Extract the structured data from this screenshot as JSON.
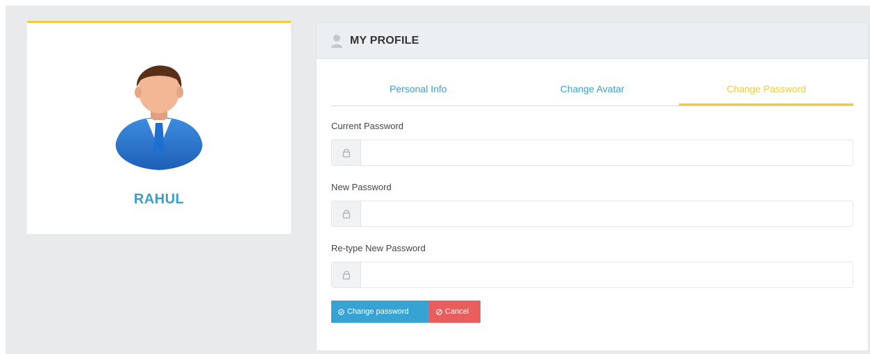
{
  "profile": {
    "name": "RAHUL"
  },
  "panel": {
    "title": "MY PROFILE"
  },
  "tabs": [
    {
      "label": "Personal Info",
      "active": false
    },
    {
      "label": "Change Avatar",
      "active": false
    },
    {
      "label": "Change Password",
      "active": true
    }
  ],
  "form": {
    "current_password_label": "Current Password",
    "new_password_label": "New Password",
    "retype_password_label": "Re-type New Password",
    "current_password_value": "",
    "new_password_value": "",
    "retype_password_value": ""
  },
  "buttons": {
    "change_password": "Change password",
    "cancel": "Cancel"
  },
  "icons": {
    "panel_header": "user-icon",
    "input_addon": "lock-icon",
    "change_password": "circle-check-icon",
    "cancel": "circle-cancel-icon"
  },
  "colors": {
    "accent_yellow": "#f2cb3c",
    "link_blue": "#3d9ec9",
    "primary": "#36a3d4",
    "danger": "#e95d5d"
  }
}
